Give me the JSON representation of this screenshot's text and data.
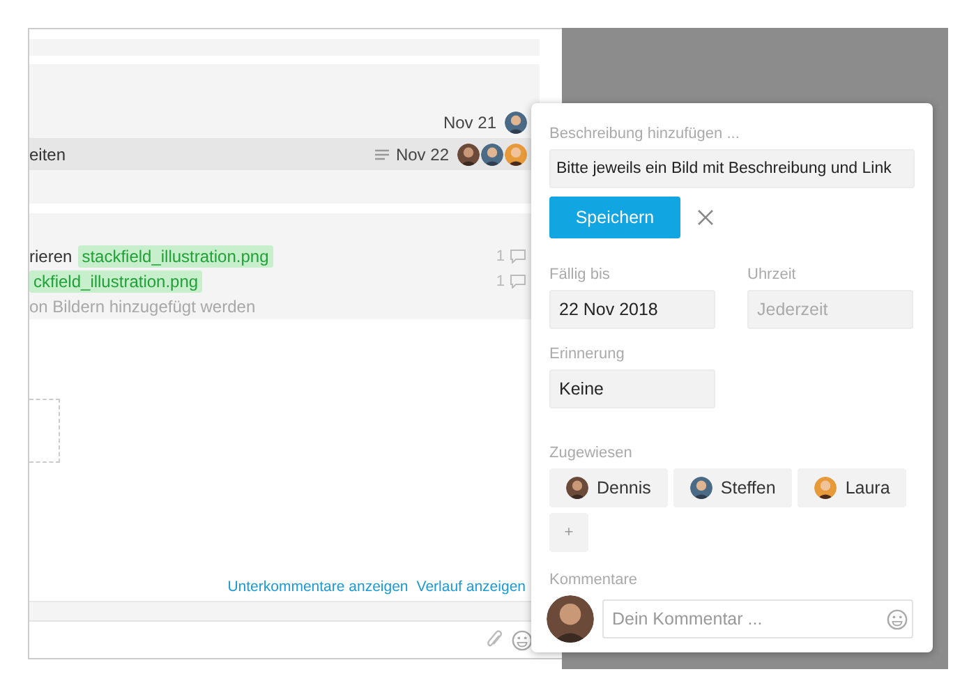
{
  "tasks": [
    {
      "date": "Nov 21",
      "selected": false,
      "has_description": false
    },
    {
      "title": "eiten",
      "date": "Nov 22",
      "selected": true,
      "has_description": true
    }
  ],
  "checklist": {
    "items": [
      {
        "text": "rieren",
        "file": "stackfield_illustration.png",
        "comments": "1"
      },
      {
        "file": "ckfield_illustration.png",
        "comments": "1"
      }
    ],
    "placeholder": "on Bildern hinzugefügt werden"
  },
  "links": [
    "Unterkommentare anzeigen",
    "Verlauf anzeigen"
  ],
  "task_popup": {
    "description": {
      "label": "Beschreibung hinzufügen ...",
      "value": "Bitte jeweils ein Bild mit Beschreibung und Link"
    },
    "save_button": "Speichern",
    "due": {
      "label": "Fällig bis",
      "value": "22 Nov 2018"
    },
    "time": {
      "label": "Uhrzeit",
      "placeholder": "Jederzeit"
    },
    "reminder": {
      "label": "Erinnerung",
      "value": "Keine"
    },
    "assignees": {
      "label": "Zugewiesen",
      "people": [
        {
          "name": "Dennis"
        },
        {
          "name": "Steffen"
        },
        {
          "name": "Laura"
        }
      ],
      "add": "+"
    },
    "comments": {
      "label": "Kommentare",
      "placeholder": "Dein Kommentar ..."
    }
  }
}
